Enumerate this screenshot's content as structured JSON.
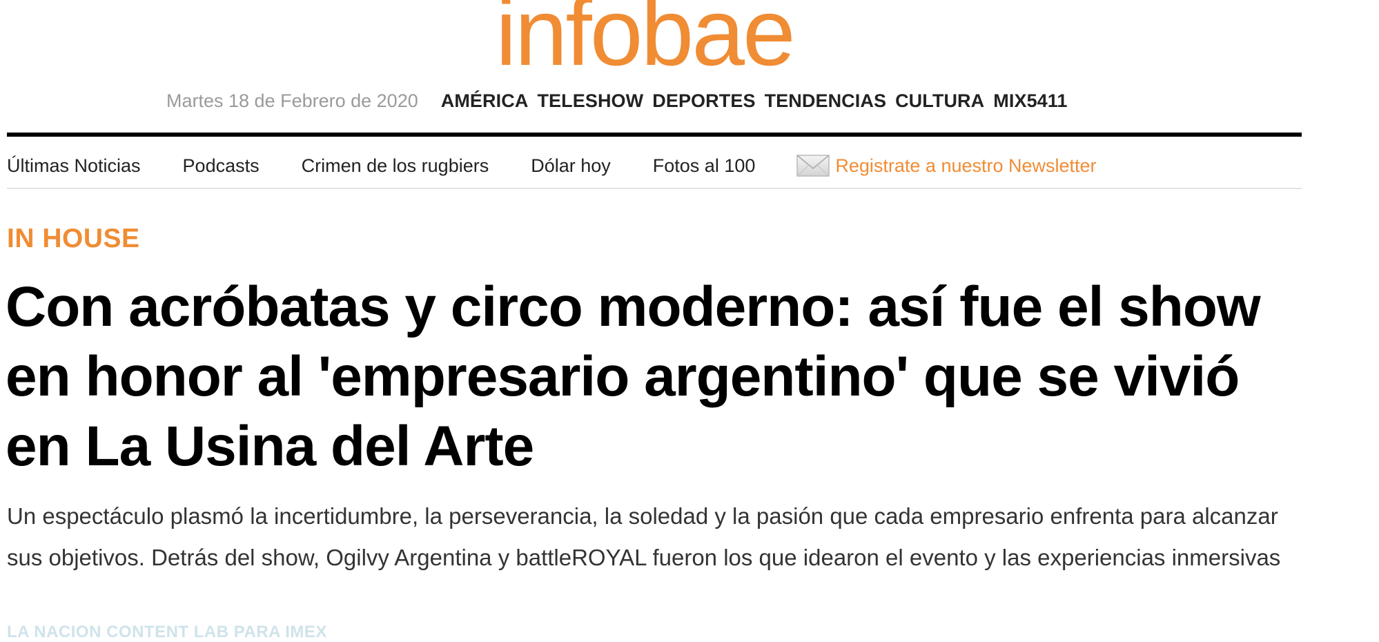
{
  "site": {
    "logo_text": "infobae",
    "brand_color": "#f08c34"
  },
  "topbar": {
    "date": "Martes 18 de Febrero de 2020",
    "sections": [
      "AMÉRICA",
      "TELESHOW",
      "DEPORTES",
      "TENDENCIAS",
      "CULTURA",
      "MIX5411"
    ]
  },
  "navbar": {
    "items": [
      "Últimas Noticias",
      "Podcasts",
      "Crimen de los rugbiers",
      "Dólar hoy",
      "Fotos al 100"
    ],
    "newsletter_icon": "mail-icon",
    "newsletter_label": "Registrate a nuestro Newsletter"
  },
  "article": {
    "kicker": "IN HOUSE",
    "headline": "Con acróbatas y circo moderno: así fue el show en honor al 'empresario argentino' que se vivió en La Usina del Arte",
    "dek": "Un espectáculo plasmó la incertidumbre, la perseverancia, la soledad y la pasión que cada empresario enfrenta para alcanzar sus objetivos. Detrás del show, Ogilvy Argentina y battleROYAL fueron los que idearon el evento y las experiencias inmersivas",
    "credit": "LA NACION CONTENT LAB PARA IMEX"
  }
}
